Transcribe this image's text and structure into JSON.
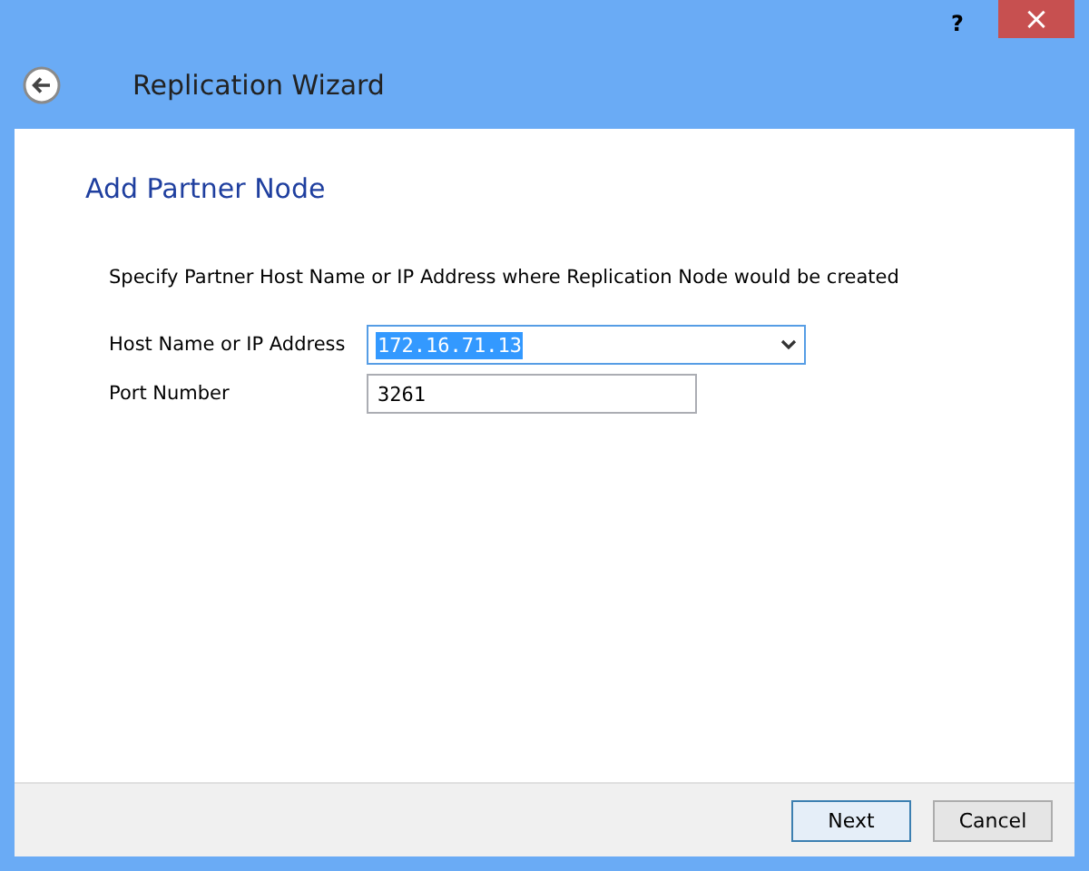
{
  "window": {
    "help": "?",
    "close": "×",
    "title": "Replication Wizard"
  },
  "page": {
    "heading": "Add Partner Node",
    "instruction": "Specify Partner Host Name or IP Address where Replication Node would be created"
  },
  "fields": [
    {
      "kind": "combo",
      "label": "Host Name or IP Address",
      "value": "172.16.71.13",
      "text_selected": true
    },
    {
      "kind": "text",
      "label": "Port Number",
      "value": "3261",
      "text_selected": false
    }
  ],
  "buttons": [
    {
      "label": "Next",
      "default": true
    },
    {
      "label": "Cancel",
      "default": false
    }
  ]
}
